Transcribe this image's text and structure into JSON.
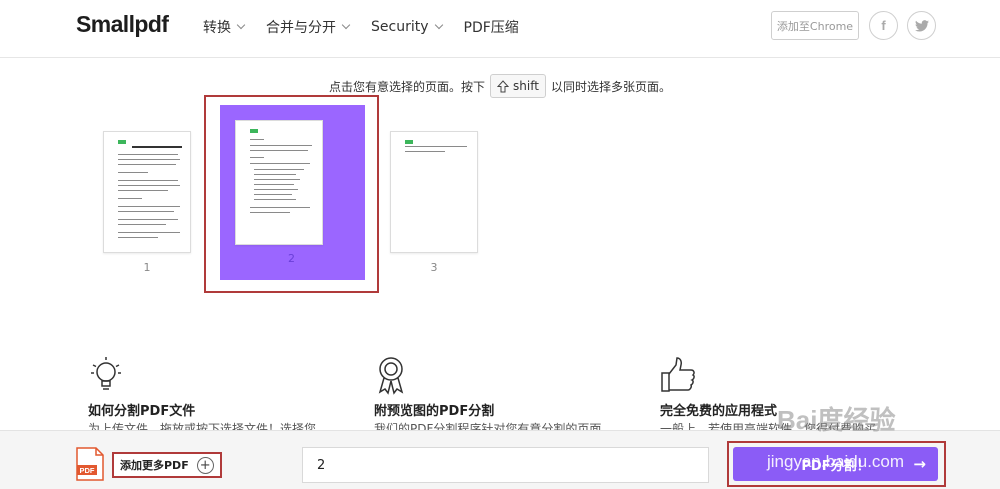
{
  "header": {
    "logo": "Smallpdf",
    "nav": [
      {
        "label": "转换"
      },
      {
        "label": "合并与分开"
      },
      {
        "label": "Security"
      },
      {
        "label": "PDF压缩"
      }
    ],
    "chrome_button": "添加至Chrome",
    "facebook_glyph": "f",
    "twitter_glyph": "t"
  },
  "instruction": {
    "before": "点击您有意选择的页面。按下",
    "key": "shift",
    "after": "以同时选择多张页面。"
  },
  "pages": [
    {
      "number": "1",
      "selected": false
    },
    {
      "number": "2",
      "selected": true
    },
    {
      "number": "3",
      "selected": false
    }
  ],
  "features": [
    {
      "title": "如何分割PDF文件",
      "desc": "为上传文件，拖放或按下选择文件！选择您",
      "icon": "lightbulb-icon"
    },
    {
      "title": "附预览图的PDF分割",
      "desc": "我们的PDF分割程序针对您有意分割的页面",
      "icon": "award-ribbon-icon"
    },
    {
      "title": "完全免费的应用程式",
      "desc": "一般上，若使用高端软件，您得付费购买",
      "icon": "thumbs-up-icon"
    }
  ],
  "bottom": {
    "add_more_label": "添加更多PDF",
    "pdf_icon_label": "PDF",
    "pages_input_value": "2",
    "split_button_label": "PDF分割！"
  },
  "colors": {
    "accent": "#8b5cf6",
    "selection": "#9b66ff",
    "highlight_frame": "#b03a3a",
    "pdf_icon": "#e2582f"
  },
  "watermark": {
    "brand": "Bai度经验",
    "url": "jingyan.baidu.com"
  }
}
